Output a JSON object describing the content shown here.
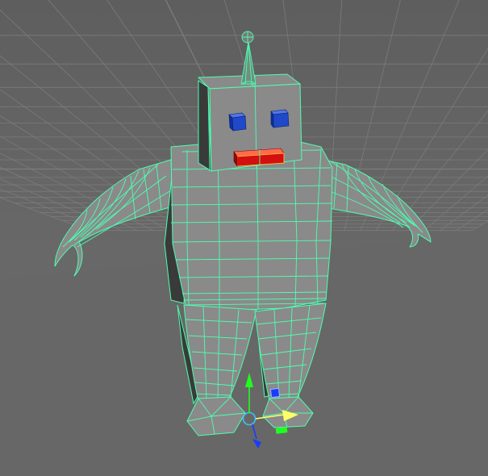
{
  "viewport": {
    "view": "perspective",
    "mesh": "robot-character",
    "selection_state": "selected",
    "tool": "move-tool",
    "shading": "smooth-shade-with-wireframe-on-shaded"
  },
  "colors": {
    "background": "#666666",
    "grid_line": "#7b7b7b",
    "grid_fill": "#676767",
    "mesh_fill": "#8a8a8a",
    "mesh_shadow": "#3a3a3a",
    "wireframe_selected": "#4dffb0",
    "eye": "#1f49c9",
    "mouth": "#d40f0f",
    "manipulator_x": "#ff3030",
    "manipulator_y": "#1fff1f",
    "manipulator_z": "#1a3cff",
    "manipulator_center": "#ffff66"
  },
  "icons": {
    "move_manipulator": "move-manipulator-icon",
    "pivot": "pivot-icon"
  }
}
